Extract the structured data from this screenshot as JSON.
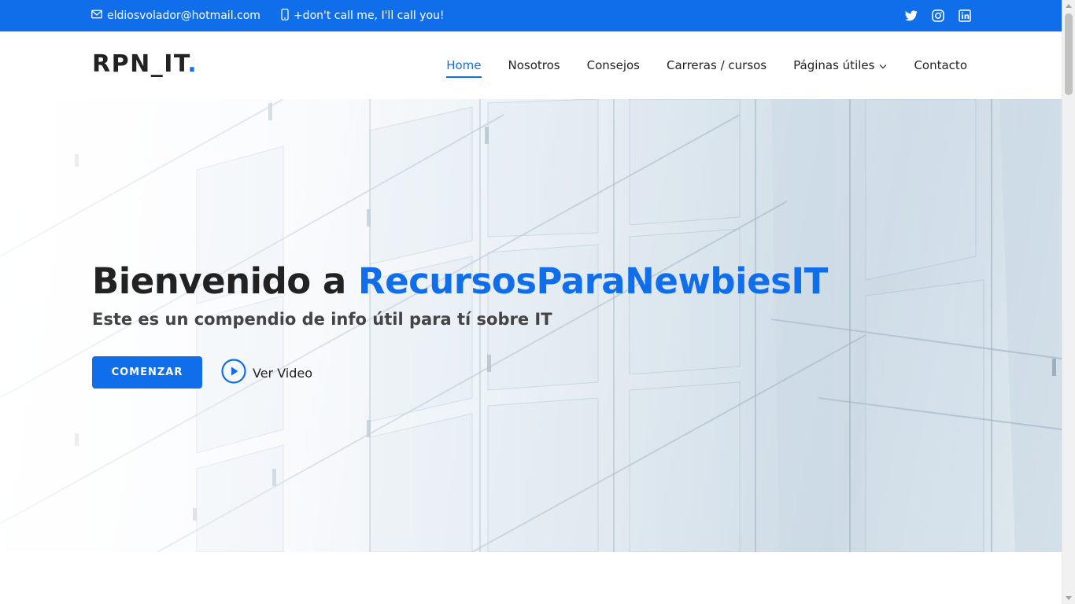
{
  "topbar": {
    "email": "eldiosvolador@hotmail.com",
    "phone": "+don't call me, I'll call you!",
    "social_icons": [
      "twitter-icon",
      "instagram-icon",
      "linkedin-icon"
    ]
  },
  "header": {
    "logo_text": "RPN_IT",
    "logo_dot": ".",
    "nav": {
      "home": "Home",
      "nosotros": "Nosotros",
      "consejos": "Consejos",
      "carreras": "Carreras / cursos",
      "paginas": "Páginas útiles",
      "contacto": "Contacto"
    },
    "active_item": "Home"
  },
  "hero": {
    "title_prefix": "Bienvenido a ",
    "title_brand": "RecursosParaNewbiesIT",
    "subtitle": "Este es un compendio de info útil para tí sobre IT",
    "start_button": "COMENZAR",
    "video_button": "Ver Video"
  },
  "colors": {
    "accent": "#106eea",
    "text": "#222222"
  }
}
